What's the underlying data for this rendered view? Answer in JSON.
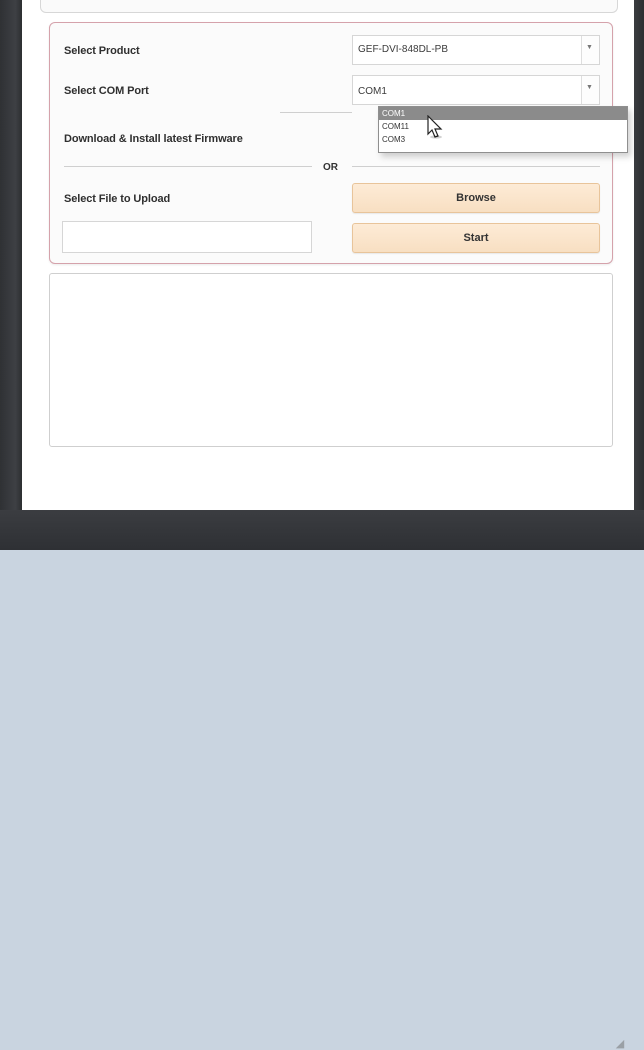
{
  "form": {
    "select_product_label": "Select Product",
    "product_value": "GEF-DVI-848DL-PB",
    "select_com_label": "Select COM Port",
    "com_value": "COM1",
    "download_label": "Download & Install latest Firmware",
    "or_text": "OR",
    "select_file_label": "Select File to Upload",
    "browse_label": "Browse",
    "start_label": "Start"
  },
  "com_dropdown": {
    "options": [
      "COM1",
      "COM11",
      "COM3"
    ],
    "selected_index": 0
  },
  "icons": {
    "dropdown_arrow": "chevron-down-icon",
    "cursor": "mouse-pointer-icon",
    "resize": "resize-grip-icon"
  },
  "colors": {
    "panel_border": "#d5a2ab",
    "button_fill": "#fdebd6",
    "selected_option": "#8b8b8b",
    "frame_dark": "#2f3134"
  }
}
